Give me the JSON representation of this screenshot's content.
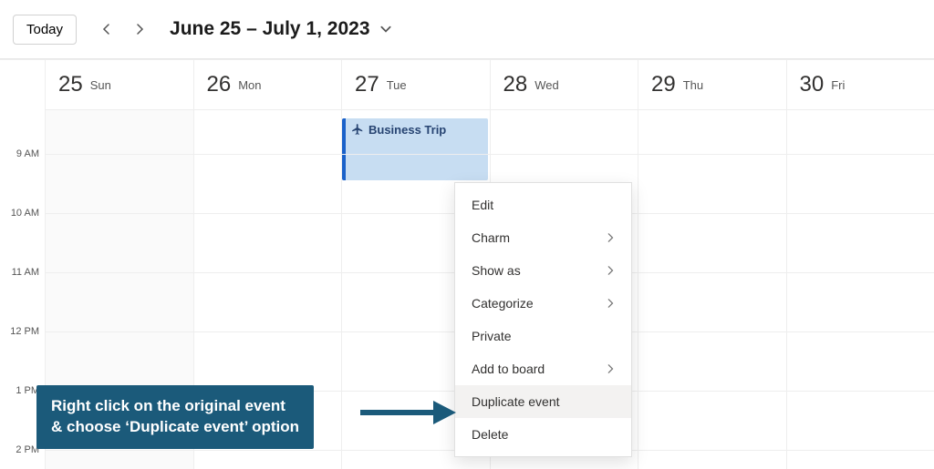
{
  "toolbar": {
    "today_label": "Today",
    "date_range": "June 25 – July 1, 2023"
  },
  "days": [
    {
      "num": "25",
      "name": "Sun",
      "weekend": true
    },
    {
      "num": "26",
      "name": "Mon",
      "weekend": false
    },
    {
      "num": "27",
      "name": "Tue",
      "weekend": false
    },
    {
      "num": "28",
      "name": "Wed",
      "weekend": false
    },
    {
      "num": "29",
      "name": "Thu",
      "weekend": false
    },
    {
      "num": "30",
      "name": "Fri",
      "weekend": false
    }
  ],
  "hours": [
    "9 AM",
    "10 AM",
    "11 AM",
    "12 PM",
    "1 PM",
    "2 PM"
  ],
  "event": {
    "title": "Business Trip",
    "day_index": 2,
    "start_hour_index": -0.6,
    "end_hour_index": 0.45
  },
  "context_menu": {
    "items": [
      {
        "label": "Edit",
        "submenu": false,
        "highlight": false
      },
      {
        "label": "Charm",
        "submenu": true,
        "highlight": false
      },
      {
        "label": "Show as",
        "submenu": true,
        "highlight": false
      },
      {
        "label": "Categorize",
        "submenu": true,
        "highlight": false
      },
      {
        "label": "Private",
        "submenu": false,
        "highlight": false
      },
      {
        "label": "Add to board",
        "submenu": true,
        "highlight": false
      },
      {
        "label": "Duplicate event",
        "submenu": false,
        "highlight": true
      },
      {
        "label": "Delete",
        "submenu": false,
        "highlight": false
      }
    ]
  },
  "annotation": {
    "line1": "Right click on the original event",
    "line2": "& choose ‘Duplicate event’ option"
  },
  "colors": {
    "event_bg": "#c7ddf2",
    "event_bar": "#1a61c9",
    "annotation_bg": "#1b5a7a"
  }
}
